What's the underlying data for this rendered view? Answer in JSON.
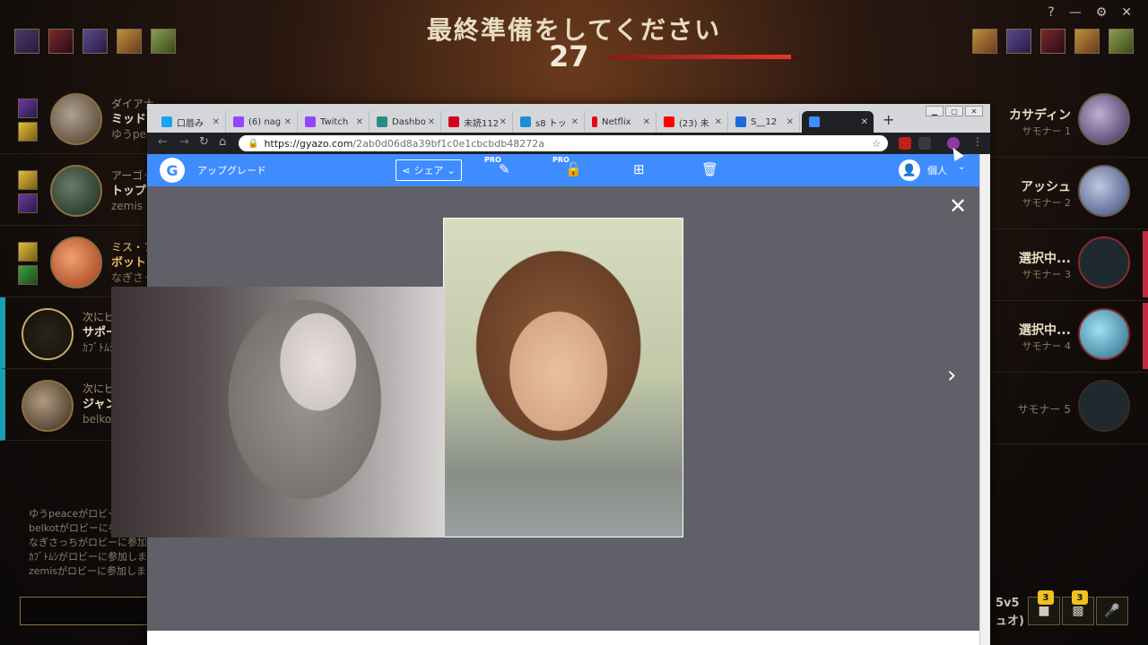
{
  "game": {
    "phase_title": "最終準備をしてください",
    "timer": "27",
    "timer_fraction": 0.9,
    "window_controls": [
      "?",
      "—",
      "⚙",
      "✕"
    ]
  },
  "left_team": [
    {
      "line1": "ダイアナ",
      "line2": "ミッド",
      "line3": "ゆうpeace"
    },
    {
      "line1": "アーゴット",
      "line2": "トップ",
      "line3": "zemis"
    },
    {
      "line1": "ミス・フォーチュン",
      "line2": "ボット",
      "line3": "なぎさっち"
    },
    {
      "line1": "次にピック",
      "line2": "サポート",
      "line3": "ｶﾌﾞﾄﾑｼ"
    },
    {
      "line1": "次にピック",
      "line2": "ジャングル",
      "line3": "belkot"
    }
  ],
  "chat": {
    "lines": [
      "ゆうpeaceがロビーに参加しました",
      "belkotがロビーに参加しました",
      "なぎさっちがロビーに参加しました",
      "ｶﾌﾞﾄﾑｼがロビーに参加しました",
      "zemisがロビーに参加しました"
    ]
  },
  "right_team": [
    {
      "name": "カサディン",
      "sub": "サモナー 1"
    },
    {
      "name": "アッシュ",
      "sub": "サモナー 2"
    },
    {
      "name": "選択中...",
      "sub": "サモナー 3"
    },
    {
      "name": "選択中...",
      "sub": "サモナー 4"
    },
    {
      "name": "",
      "sub": "サモナー 5"
    }
  ],
  "queue": {
    "line1": "5v5",
    "line2": "ュオ)"
  },
  "bottom_buttons": [
    {
      "icon": "chat-icon",
      "badge": "3"
    },
    {
      "icon": "friends-icon",
      "badge": "3"
    },
    {
      "icon": "mic-icon",
      "badge": ""
    }
  ],
  "browser": {
    "tabs": [
      {
        "label": "口唇み",
        "color": "#1da1f2"
      },
      {
        "label": "(6) nag",
        "color": "#9146ff"
      },
      {
        "label": "Twitch",
        "color": "#9146ff"
      },
      {
        "label": "Dashbo",
        "color": "#2a8a8a"
      },
      {
        "label": "未読112",
        "color": "#d0021b"
      },
      {
        "label": "s8 トッ",
        "color": "#1a8fd8"
      },
      {
        "label": "Netflix",
        "color": "#e50914"
      },
      {
        "label": "(23) 未",
        "color": "#ff0000"
      },
      {
        "label": "S__12",
        "color": "#1a6ad8"
      },
      {
        "label": "",
        "color": "#3f8cff"
      }
    ],
    "new_tab": "+",
    "url_host": "https://gyazo.com",
    "url_path": "/2ab0d06d8a39bf1c0e1cbcbdb48272a"
  },
  "gyazo": {
    "upgrade": "アップグレード",
    "share": "シェア",
    "pro": "PRO",
    "user": "個人"
  }
}
